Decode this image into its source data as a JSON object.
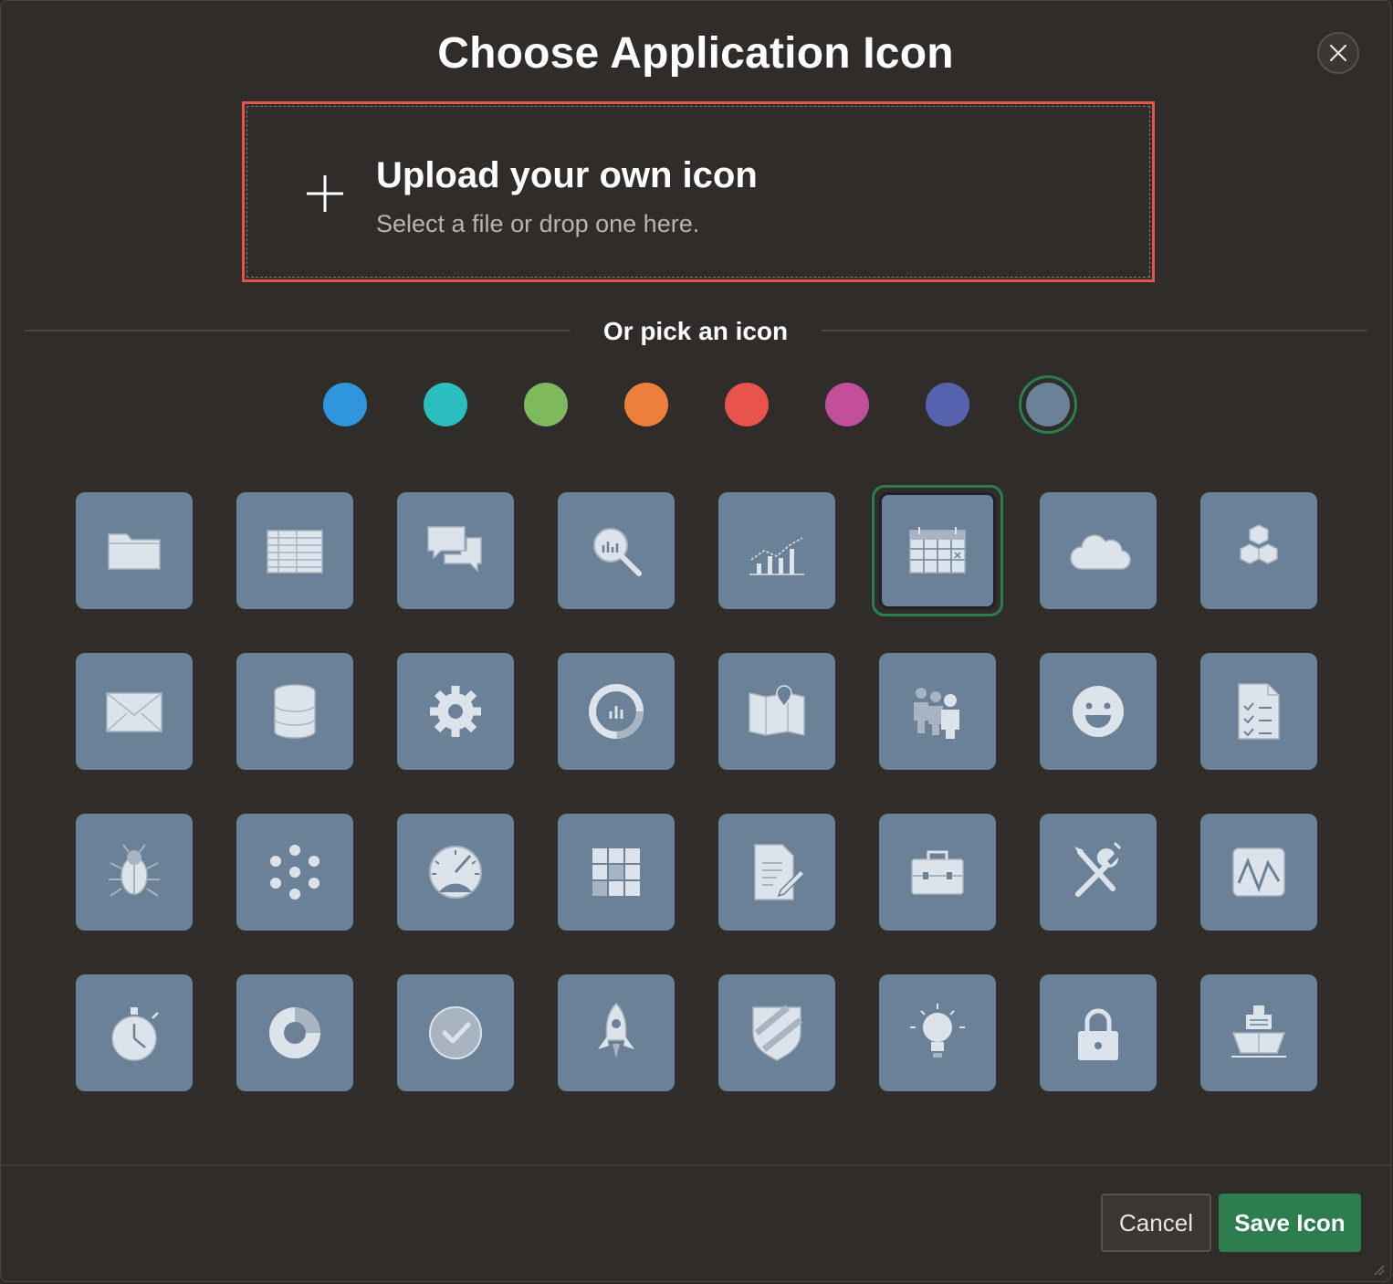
{
  "dialog": {
    "title": "Choose Application Icon",
    "close_icon": "close-icon"
  },
  "upload": {
    "title": "Upload your own icon",
    "subtitle": "Select a file or drop one here.",
    "icon": "plus-icon",
    "border_color": "#e8534b"
  },
  "picker": {
    "label": "Or pick an icon",
    "colors": [
      "#2f96de",
      "#2abfbe",
      "#7fb95e",
      "#ec7f3c",
      "#e8534b",
      "#c34f9b",
      "#5662ae",
      "#6b8198"
    ],
    "selected_color_index": 7,
    "selected_icon_index": 5,
    "icons": [
      "folder-icon",
      "spreadsheet-icon",
      "chat-icon",
      "search-chart-icon",
      "line-bar-chart-icon",
      "calendar-icon",
      "cloud-icon",
      "cubes-icon",
      "mail-icon",
      "database-icon",
      "gear-icon",
      "donut-gauge-icon",
      "map-icon",
      "people-icon",
      "smiley-icon",
      "checklist-icon",
      "bug-icon",
      "dots-cluster-icon",
      "speedometer-icon",
      "grid-icon",
      "edit-document-icon",
      "briefcase-icon",
      "tools-icon",
      "waveform-icon",
      "stopwatch-icon",
      "pie-chart-icon",
      "check-circle-icon",
      "rocket-icon",
      "shield-icon",
      "lightbulb-icon",
      "lock-icon",
      "ship-icon"
    ]
  },
  "footer": {
    "cancel_label": "Cancel",
    "save_label": "Save Icon"
  }
}
